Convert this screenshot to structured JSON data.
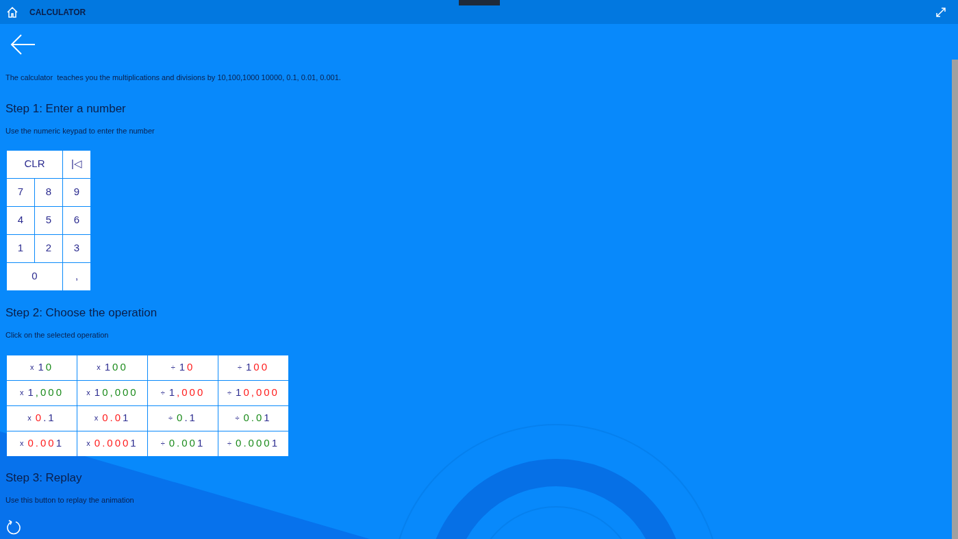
{
  "app_bar": {
    "title": "CALCULATOR"
  },
  "intro": "The calculator  teaches you the multiplications and divisions by 10,100,1000 10000, 0.1, 0.01, 0.001.",
  "step1": {
    "heading": "Step 1: Enter a number",
    "hint": "Use the numeric keypad to enter the number",
    "keys": [
      {
        "label": "CLR",
        "wide": true
      },
      {
        "label": "|◁",
        "wide": false
      },
      {
        "label": "7",
        "wide": false
      },
      {
        "label": "8",
        "wide": false
      },
      {
        "label": "9",
        "wide": false
      },
      {
        "label": "4",
        "wide": false
      },
      {
        "label": "5",
        "wide": false
      },
      {
        "label": "6",
        "wide": false
      },
      {
        "label": "1",
        "wide": false
      },
      {
        "label": "2",
        "wide": false
      },
      {
        "label": "3",
        "wide": false
      },
      {
        "label": "0",
        "wide": true
      },
      {
        "label": ",",
        "wide": false
      }
    ]
  },
  "step2": {
    "heading": "Step 2: Choose the operation",
    "hint": "Click on the selected operation",
    "operations": [
      {
        "sign": "x",
        "parts": [
          {
            "text": "1",
            "color": "#2b2b8f"
          },
          {
            "text": "0",
            "color": "#1a8a1a"
          }
        ]
      },
      {
        "sign": "x",
        "parts": [
          {
            "text": "1",
            "color": "#2b2b8f"
          },
          {
            "text": "00",
            "color": "#1a8a1a"
          }
        ]
      },
      {
        "sign": "÷",
        "parts": [
          {
            "text": "1",
            "color": "#2b2b8f"
          },
          {
            "text": "0",
            "color": "#ff1a1a"
          }
        ]
      },
      {
        "sign": "÷",
        "parts": [
          {
            "text": "1",
            "color": "#2b2b8f"
          },
          {
            "text": "00",
            "color": "#ff1a1a"
          }
        ]
      },
      {
        "sign": "x",
        "parts": [
          {
            "text": "1",
            "color": "#2b2b8f"
          },
          {
            "text": ",000",
            "color": "#1a8a1a"
          }
        ]
      },
      {
        "sign": "x",
        "parts": [
          {
            "text": "1",
            "color": "#2b2b8f"
          },
          {
            "text": "0,000",
            "color": "#1a8a1a"
          }
        ]
      },
      {
        "sign": "÷",
        "parts": [
          {
            "text": "1",
            "color": "#2b2b8f"
          },
          {
            "text": ",000",
            "color": "#ff1a1a"
          }
        ]
      },
      {
        "sign": "÷",
        "parts": [
          {
            "text": "1",
            "color": "#2b2b8f"
          },
          {
            "text": "0,000",
            "color": "#ff1a1a"
          }
        ]
      },
      {
        "sign": "x",
        "parts": [
          {
            "text": "0",
            "color": "#ff1a1a"
          },
          {
            "text": ".1",
            "color": "#2b2b8f"
          }
        ]
      },
      {
        "sign": "x",
        "parts": [
          {
            "text": "0.0",
            "color": "#ff1a1a"
          },
          {
            "text": "1",
            "color": "#2b2b8f"
          }
        ]
      },
      {
        "sign": "÷",
        "parts": [
          {
            "text": "0",
            "color": "#1a8a1a"
          },
          {
            "text": ".1",
            "color": "#2b2b8f"
          }
        ]
      },
      {
        "sign": "÷",
        "parts": [
          {
            "text": "0.0",
            "color": "#1a8a1a"
          },
          {
            "text": "1",
            "color": "#2b2b8f"
          }
        ]
      },
      {
        "sign": "x",
        "parts": [
          {
            "text": "0.00",
            "color": "#ff1a1a"
          },
          {
            "text": "1",
            "color": "#2b2b8f"
          }
        ]
      },
      {
        "sign": "x",
        "parts": [
          {
            "text": "0.000",
            "color": "#ff1a1a"
          },
          {
            "text": "1",
            "color": "#2b2b8f"
          }
        ]
      },
      {
        "sign": "÷",
        "parts": [
          {
            "text": "0.00",
            "color": "#1a8a1a"
          },
          {
            "text": "1",
            "color": "#2b2b8f"
          }
        ]
      },
      {
        "sign": "÷",
        "parts": [
          {
            "text": "0.000",
            "color": "#1a8a1a"
          },
          {
            "text": "1",
            "color": "#2b2b8f"
          }
        ]
      }
    ]
  },
  "step3": {
    "heading": "Step 3: Replay",
    "hint": "Use this button to replay the animation"
  }
}
